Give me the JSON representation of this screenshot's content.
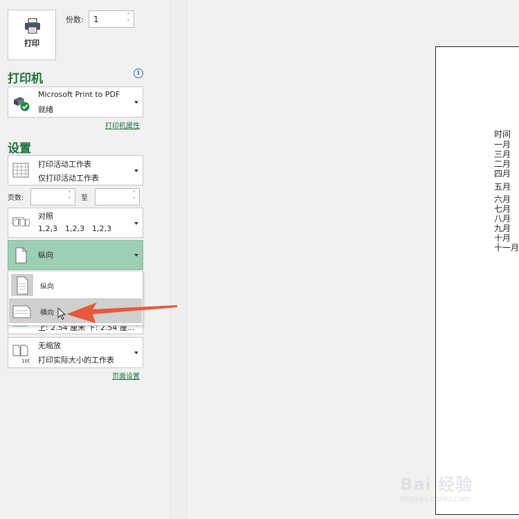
{
  "print": {
    "button_label": "打印"
  },
  "copies": {
    "label": "份数:",
    "value": "1"
  },
  "printer": {
    "section_title": "打印机",
    "name": "Microsoft Print to PDF",
    "status": "就绪",
    "properties_link": "打印机属性"
  },
  "settings": {
    "section_title": "设置",
    "scope": {
      "line1": "打印活动工作表",
      "line2": "仅打印活动工作表"
    },
    "pages": {
      "label": "页数:",
      "to_label": "至",
      "from_value": "",
      "to_value": ""
    },
    "collate": {
      "line1": "对照",
      "line2a": "1,2,3",
      "line2b": "1,2,3",
      "line2c": "1,2,3"
    },
    "orientation": {
      "selected": "纵向"
    },
    "orientation_menu": [
      {
        "label": "纵向"
      },
      {
        "label": "横向"
      }
    ],
    "margins_partial": "上: 2.54 厘米  下: 2.54 厘...",
    "scaling": {
      "line1": "无缩放",
      "line2": "打印实际大小的工作表"
    },
    "page_setup_link": "页面设置"
  },
  "preview": {
    "column_values": [
      "时间",
      "一月",
      "三月",
      "二月",
      "四月",
      "五月",
      "六月",
      "七月",
      "八月",
      "九月",
      "十月",
      "十一月"
    ]
  },
  "watermark": {
    "main": "Bai 经验",
    "sub": "jingyan.baidu.com"
  },
  "colors": {
    "accent_green": "#1e6e3e",
    "selected_fill": "#9ccfb3",
    "arrow": "#e8583a"
  }
}
